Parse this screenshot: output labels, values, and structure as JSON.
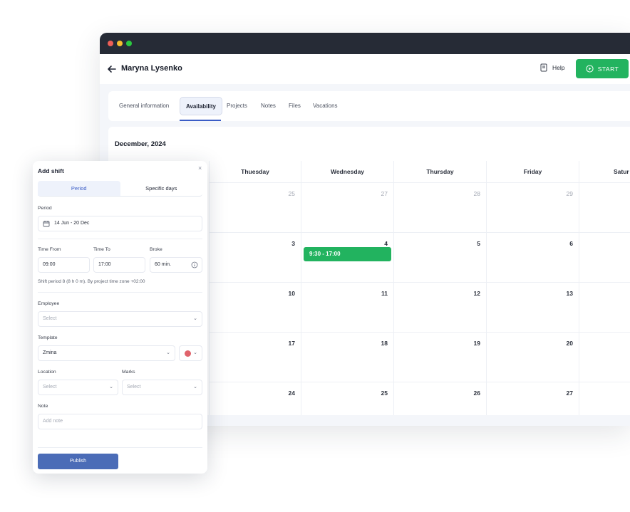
{
  "app": {
    "user_name": "Maryna Lysenko",
    "help_label": "Help",
    "start_label": "START",
    "accent_green": "#22b35f",
    "accent_blue": "#3a5cc6"
  },
  "tabs": [
    {
      "label": "General information"
    },
    {
      "label": "Availability"
    },
    {
      "label": "Projects"
    },
    {
      "label": "Notes"
    },
    {
      "label": "Files"
    },
    {
      "label": "Vacations"
    }
  ],
  "calendar": {
    "month": "December, 2024",
    "days": [
      "Thuesday",
      "Wednesday",
      "Thursday",
      "Friday",
      "Satur"
    ],
    "weeks": [
      [
        "25",
        "27",
        "28",
        "29",
        ""
      ],
      [
        "3",
        "4",
        "5",
        "6",
        ""
      ],
      [
        "10",
        "11",
        "12",
        "13",
        ""
      ],
      [
        "17",
        "18",
        "19",
        "20",
        ""
      ],
      [
        "24",
        "25",
        "26",
        "27",
        ""
      ]
    ],
    "event": "9:30 - 17:00"
  },
  "panel": {
    "title": "Add shift",
    "close": "×",
    "seg_period": "Period",
    "seg_specific": "Specific days",
    "period_label": "Period",
    "period_value": "14 Jun - 20 Dec",
    "time_from_label": "Time From",
    "time_from_value": "09:00",
    "time_to_label": "Time To",
    "time_to_value": "17:00",
    "broke_label": "Broke",
    "broke_value": "60 min.",
    "hint": "Shift period 8 (8 h 0 m). By project time zone +02:00",
    "employee_label": "Employee",
    "employee_placeholder": "Select",
    "template_label": "Template",
    "template_value": "Zmina",
    "location_label": "Location",
    "location_placeholder": "Select",
    "marks_label": "Marks",
    "marks_placeholder": "Select",
    "note_label": "Note",
    "note_placeholder": "Add note",
    "publish_label": "Publish"
  }
}
